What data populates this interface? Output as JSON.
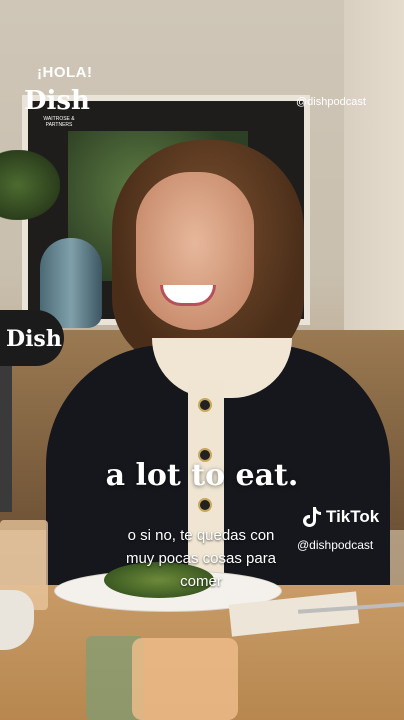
{
  "branding": {
    "hola": "¡HOLA!",
    "logo": "Dish",
    "logo_sub": "WAITROSE & PARTNERS",
    "handle_top": "@dishpodcast"
  },
  "mic_label": "Dish",
  "caption": {
    "main": "a lot to eat.",
    "subtitle_lines": [
      "o si no, te quedas con",
      "muy pocas cosas para",
      "comer"
    ]
  },
  "tiktok": {
    "icon": "tiktok-note-icon",
    "name": "TikTok",
    "handle": "@dishpodcast"
  }
}
